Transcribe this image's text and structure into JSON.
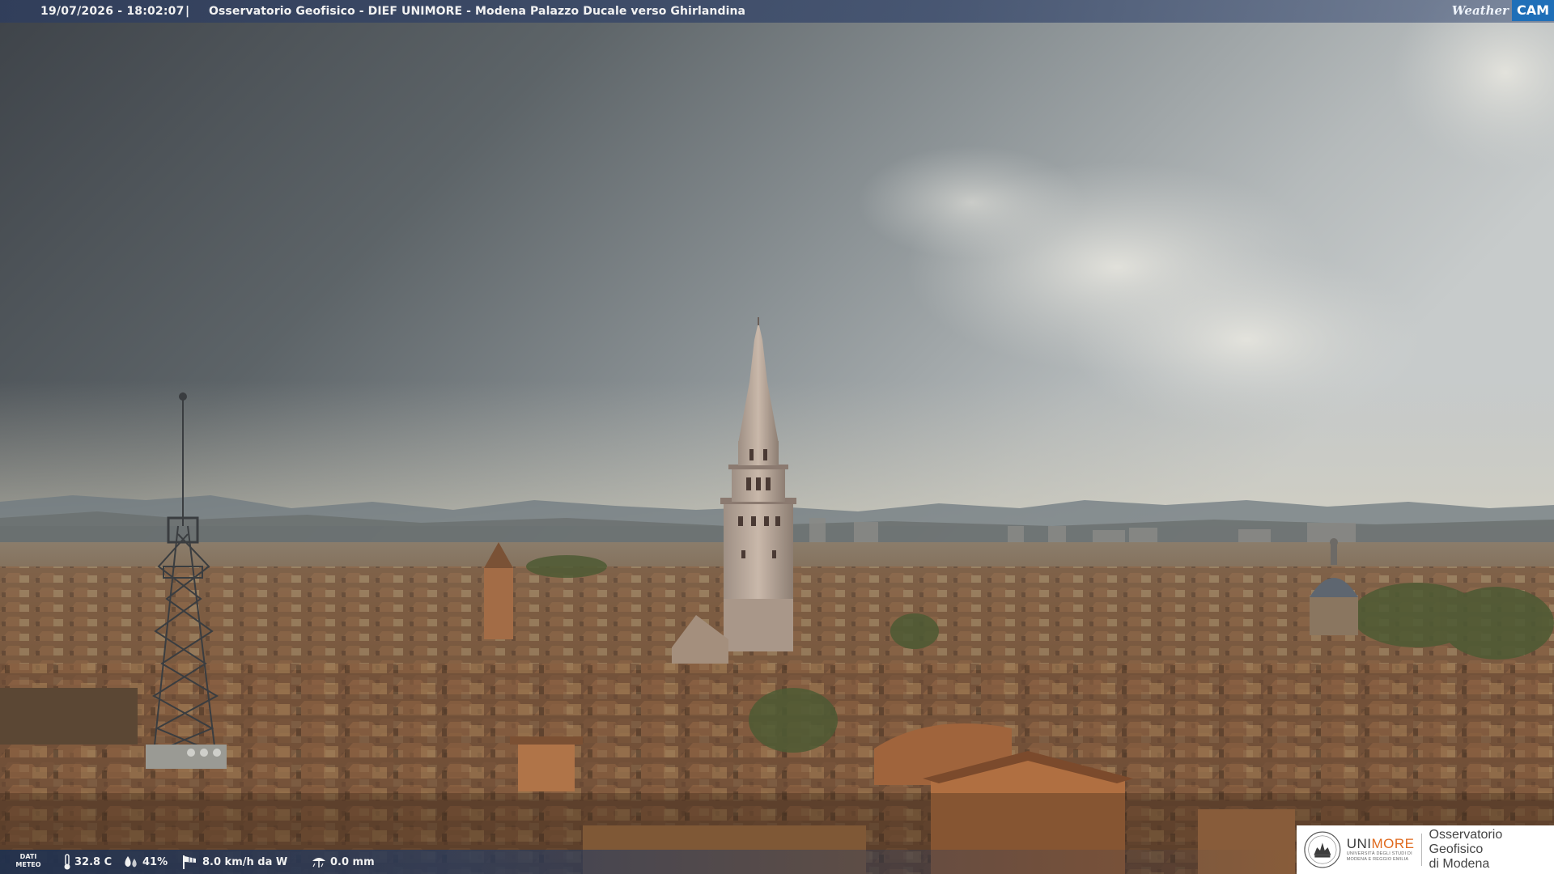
{
  "caption": {
    "timestamp": "19/07/2026 - 18:02:07",
    "separator": "|",
    "title": "Osservatorio Geofisico - DIEF UNIMORE - Modena Palazzo Ducale verso Ghirlandina"
  },
  "webcam_brand": {
    "weather": "Weather",
    "cam": "CAM"
  },
  "weather_data": {
    "label_line1": "DATI",
    "label_line2": "METEO",
    "temperature": "32.8 C",
    "humidity": "41%",
    "wind": "8.0 km/h da W",
    "rain": "0.0 mm",
    "icons": [
      "thermometer-icon",
      "humidity-drops-icon",
      "wind-sock-icon",
      "rain-gauge-icon"
    ]
  },
  "logo": {
    "uni": "UNI",
    "more": "MORE",
    "sub_line1": "Università degli studi di",
    "sub_line2": "Modena e Reggio Emilia",
    "observatory_line1": "Osservatorio Geofisico",
    "observatory_line2": "di Modena",
    "brand_color": "#e06a1e"
  },
  "colors": {
    "caption_bar": "#303e5c",
    "weather_bar": "#1e3050",
    "cam_badge": "#1f6fb8"
  }
}
